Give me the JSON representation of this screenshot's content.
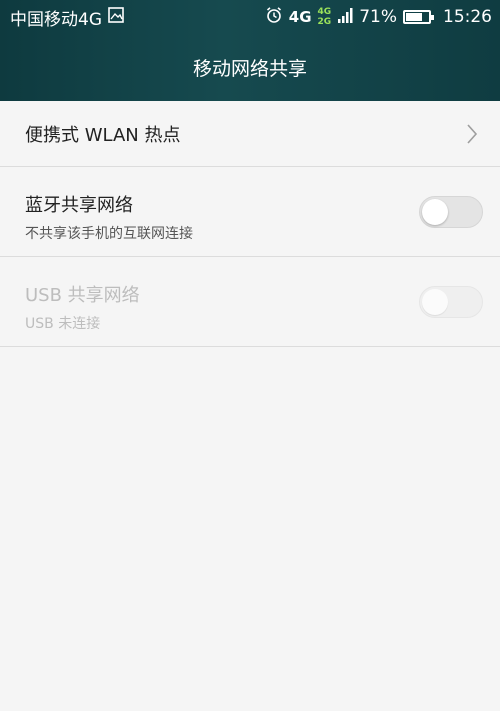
{
  "status_bar": {
    "carrier": "中国移动4G",
    "network_4g": "4G",
    "net_4g_small": "4G",
    "net_2g_small": "2G",
    "battery_percent": "71%",
    "battery_level": 0.71,
    "time": "15:26"
  },
  "header": {
    "title": "移动网络共享"
  },
  "items": [
    {
      "label": "便携式 WLAN 热点"
    },
    {
      "label": "蓝牙共享网络",
      "subtitle": "不共享该手机的互联网连接",
      "enabled": false
    },
    {
      "label": "USB 共享网络",
      "subtitle": "USB 未连接",
      "enabled": false,
      "disabled": true
    }
  ],
  "icons": {
    "image": "image-icon",
    "alarm": "alarm-icon",
    "signal": "signal-icon",
    "battery": "battery-icon",
    "chevron": "chevron-right-icon"
  }
}
